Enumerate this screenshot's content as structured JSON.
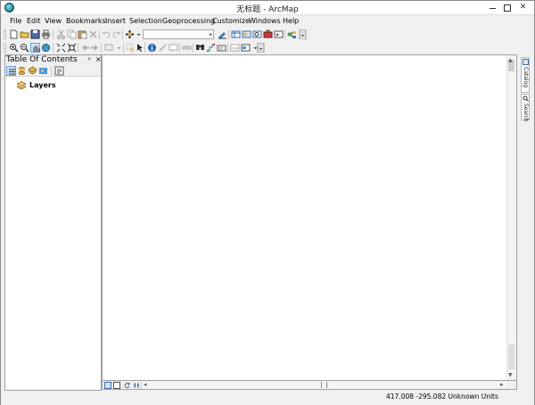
{
  "window": {
    "title": "无标题 - ArcMap"
  },
  "menu": [
    "File",
    "Edit",
    "View",
    "Bookmarks",
    "Insert",
    "Selection",
    "Geoprocessing",
    "Customize",
    "Windows",
    "Help"
  ],
  "toolbar": {
    "scale_value": "",
    "row1_icons": [
      "new-document-icon",
      "open-folder-icon",
      "save-icon",
      "print-icon",
      "cut-icon",
      "copy-icon",
      "paste-icon",
      "delete-icon",
      "undo-icon",
      "redo-icon",
      "add-data-icon",
      "editor-toolbar-icon",
      "table-window-icon",
      "catalog-window-icon",
      "search-window-icon",
      "arctoolbox-icon",
      "python-window-icon",
      "modelbuilder-icon"
    ],
    "row2_icons": [
      "zoom-in-icon",
      "zoom-out-icon",
      "pan-icon",
      "full-extent-icon",
      "fixed-zoom-in-icon",
      "fixed-zoom-out-icon",
      "back-extent-icon",
      "forward-extent-icon",
      "select-features-icon",
      "select-elements-icon",
      "identify-icon",
      "hyperlink-icon",
      "html-popup-icon",
      "measure-icon",
      "find-icon",
      "find-route-icon",
      "go-to-xy-icon",
      "time-slider-icon",
      "viewer-window-icon"
    ]
  },
  "toc": {
    "title": "Table Of Contents",
    "pin": "ᵖ",
    "close": "×",
    "layers_label": "Layers"
  },
  "dock": {
    "catalog_label": "Catalog",
    "search_label": "Search"
  },
  "status": {
    "coordinates": "417.008  -295.082 Unknown Units"
  },
  "colors": {
    "accent": "#1f7f95",
    "folder": "#e8b84a"
  }
}
